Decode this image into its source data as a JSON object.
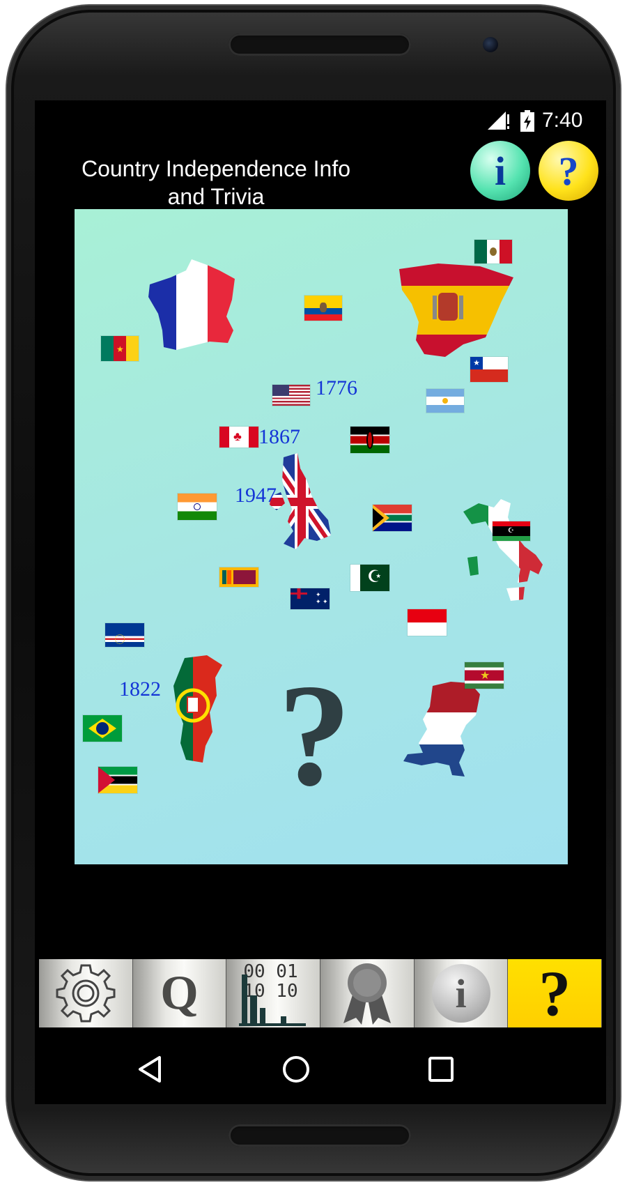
{
  "status": {
    "time": "7:40"
  },
  "header": {
    "title_line1": "Country Independence Info",
    "title_line2": "and Trivia",
    "info_label": "i",
    "help_label": "?"
  },
  "canvas": {
    "years": [
      "1776",
      "1867",
      "1947",
      "1822"
    ],
    "big_label": "?"
  },
  "bottom_tabs": [
    {
      "name": "settings",
      "icon": "gear-icon"
    },
    {
      "name": "quiz",
      "label": "Q"
    },
    {
      "name": "stats",
      "binary": "00 01\n10 10"
    },
    {
      "name": "awards",
      "icon": "ribbon-icon"
    },
    {
      "name": "info",
      "label": "i"
    },
    {
      "name": "help",
      "label": "?"
    }
  ],
  "navigation": [
    "back-icon",
    "home-icon",
    "recents-icon"
  ],
  "colors": {
    "canvas_top": "#a8f0d6",
    "canvas_bottom": "#a1e1ef",
    "year_text": "#1435d6",
    "active_tab": "#ffd800"
  }
}
